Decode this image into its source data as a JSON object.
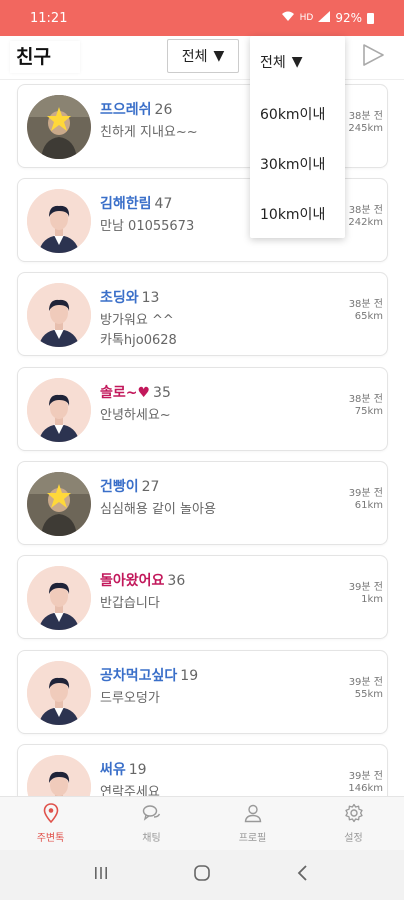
{
  "status_bar": {
    "time": "11:21",
    "battery": "92%",
    "network": "HD"
  },
  "header": {
    "title": "친구",
    "filter_label": "전체"
  },
  "dropdown": {
    "options": [
      "전체",
      "60km이내",
      "30km이내",
      "10km이내"
    ]
  },
  "friends": [
    {
      "name": "프으레쉬",
      "age": "26",
      "message": "친하게 지내요~~",
      "time": "38분 전",
      "distance": "245km",
      "avatar": "photo-person",
      "name_color": "blue"
    },
    {
      "name": "김해한림",
      "age": "47",
      "message": "만남 01055673",
      "time": "38분 전",
      "distance": "242km",
      "avatar": "default-male",
      "name_color": "blue"
    },
    {
      "name": "초딩와",
      "age": "13",
      "message": "방가워요 ^^\n카톡hjo0628",
      "time": "38분 전",
      "distance": "65km",
      "avatar": "default-male",
      "name_color": "blue"
    },
    {
      "name": "솔로~♥",
      "age": "35",
      "message": "안녕하세요~",
      "time": "38분 전",
      "distance": "75km",
      "avatar": "default-male",
      "name_color": "pink"
    },
    {
      "name": "건빵이",
      "age": "27",
      "message": "심심해용 같이 놀아용",
      "time": "39분 전",
      "distance": "61km",
      "avatar": "photo-person",
      "name_color": "blue"
    },
    {
      "name": "돌아왔어요",
      "age": "36",
      "message": "반갑습니다",
      "time": "39분 전",
      "distance": "1km",
      "avatar": "default-male",
      "name_color": "pink"
    },
    {
      "name": "공차먹고싶다",
      "age": "19",
      "message": "드루오덩가",
      "time": "39분 전",
      "distance": "55km",
      "avatar": "default-male",
      "name_color": "blue"
    },
    {
      "name": "써유",
      "age": "19",
      "message": "연락주세요",
      "time": "39분 전",
      "distance": "146km",
      "avatar": "default-male",
      "name_color": "blue"
    }
  ],
  "bottom_nav": [
    {
      "label": "주변톡",
      "icon": "location-pin-icon",
      "active": true
    },
    {
      "label": "채팅",
      "icon": "chat-bubbles-icon",
      "active": false
    },
    {
      "label": "프로필",
      "icon": "person-icon",
      "active": false
    },
    {
      "label": "설정",
      "icon": "gear-icon",
      "active": false
    }
  ],
  "colors": {
    "status_bar": "#f2675f",
    "accent": "#e0524b",
    "name_blue": "#3a6fc9",
    "name_pink": "#c2185b"
  }
}
